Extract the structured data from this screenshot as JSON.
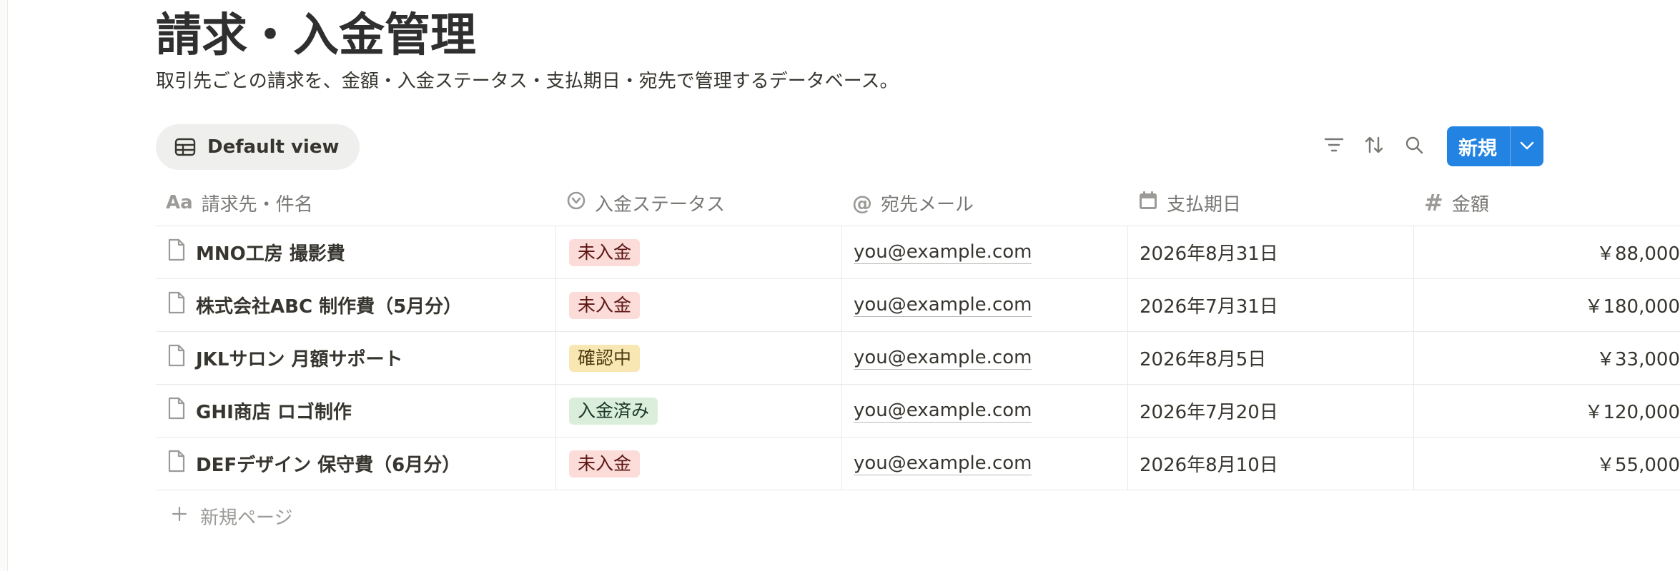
{
  "page": {
    "title": "請求・入金管理",
    "description": "取引先ごとの請求を、金額・入金ステータス・支払期日・宛先で管理するデータベース。"
  },
  "view": {
    "label": "Default view",
    "icon": "table-icon"
  },
  "toolbar": {
    "filter_icon": "filter-icon",
    "sort_icon": "sort-icon",
    "search_icon": "search-icon",
    "new_label": "新規",
    "new_dropdown_icon": "chevron-down-icon",
    "accent": "#2383e2"
  },
  "columns": [
    {
      "label": "請求先・件名",
      "icon": "text-icon"
    },
    {
      "label": "入金ステータス",
      "icon": "status-icon"
    },
    {
      "label": "宛先メール",
      "icon": "at-icon"
    },
    {
      "label": "支払期日",
      "icon": "calendar-icon"
    },
    {
      "label": "金額",
      "icon": "hash-icon"
    }
  ],
  "status_colors": {
    "未入金": {
      "bg": "#fbdcd8",
      "fg": "#5d1715"
    },
    "確認中": {
      "bg": "#f8e7b2",
      "fg": "#4e3b10"
    },
    "入金済み": {
      "bg": "#dbeddb",
      "fg": "#1c3829"
    }
  },
  "rows": [
    {
      "title": "MNO工房 撮影費",
      "status": "未入金",
      "email": "you@example.com",
      "due": "2026年8月31日",
      "amount": "￥88,000"
    },
    {
      "title": "株式会社ABC 制作費（5月分）",
      "status": "未入金",
      "email": "you@example.com",
      "due": "2026年7月31日",
      "amount": "￥180,000"
    },
    {
      "title": "JKLサロン 月額サポート",
      "status": "確認中",
      "email": "you@example.com",
      "due": "2026年8月5日",
      "amount": "￥33,000"
    },
    {
      "title": "GHI商店 ロゴ制作",
      "status": "入金済み",
      "email": "you@example.com",
      "due": "2026年7月20日",
      "amount": "￥120,000"
    },
    {
      "title": "DEFデザイン 保守費（6月分）",
      "status": "未入金",
      "email": "you@example.com",
      "due": "2026年8月10日",
      "amount": "￥55,000"
    }
  ],
  "new_page_label": "新規ページ"
}
